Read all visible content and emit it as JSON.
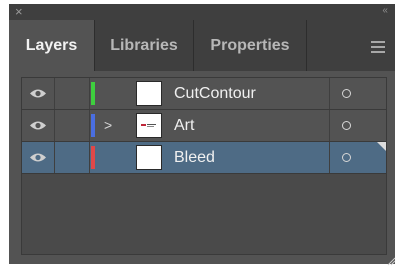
{
  "window": {
    "close_icon": "close-icon",
    "collapse_glyph": "‹‹"
  },
  "tabs": [
    {
      "label": "Layers",
      "active": true
    },
    {
      "label": "Libraries",
      "active": false
    },
    {
      "label": "Properties",
      "active": false
    }
  ],
  "panel_menu_icon": "hamburger-menu-icon",
  "layers": [
    {
      "name": "CutContour",
      "visible": true,
      "color": "#3ecf3e",
      "expandable": false,
      "thumbnail": "blank",
      "selected": false
    },
    {
      "name": "Art",
      "visible": true,
      "color": "#4a6ee0",
      "expandable": true,
      "thumbnail": "art",
      "selected": false
    },
    {
      "name": "Bleed",
      "visible": true,
      "color": "#e04848",
      "expandable": false,
      "thumbnail": "blank",
      "selected": true
    }
  ],
  "colors": {
    "panel_bg": "#535353",
    "tab_bar_bg": "#3f3f3f",
    "selected_row": "#4e6b85"
  }
}
